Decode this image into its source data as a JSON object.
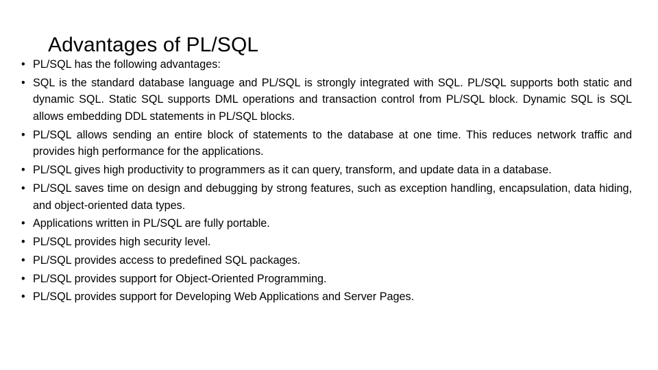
{
  "slide": {
    "title": "Advantages of PL/SQL",
    "bullet_marker": "•",
    "background_color": "#ffffff",
    "text_color": "#000000",
    "bullets": [
      {
        "id": "intro",
        "text": "PL/SQL has the following advantages:",
        "wraps": false
      },
      {
        "id": "standard-language",
        "text": "SQL is the standard database language and PL/SQL is strongly integrated with SQL. PL/SQL supports both static and dynamic SQL. Static SQL supports DML operations and transaction control from PL/SQL block. Dynamic SQL is SQL allows embedding DDL statements in PL/SQL blocks.",
        "wraps": true
      },
      {
        "id": "block-sending",
        "text": "PL/SQL allows sending an entire block of statements to the database at one time. This reduces network traffic and provides high performance for the applications.",
        "wraps": true
      },
      {
        "id": "productivity",
        "text": "PL/SQL gives high productivity to programmers as it can query, transform, and update data in a database.",
        "wraps": true
      },
      {
        "id": "saves-time",
        "text": "PL/SQL saves time on design and debugging by strong features, such as exception handling, encapsulation, data hiding, and object-oriented data types.",
        "wraps": true
      },
      {
        "id": "portable",
        "text": "Applications written in PL/SQL are fully portable.",
        "wraps": false
      },
      {
        "id": "security",
        "text": "PL/SQL provides high security level.",
        "wraps": false
      },
      {
        "id": "predefined-packages",
        "text": "PL/SQL provides access to predefined SQL packages.",
        "wraps": false
      },
      {
        "id": "oop-support",
        "text": "PL/SQL provides support for Object-Oriented Programming.",
        "wraps": false
      },
      {
        "id": "web-support",
        "text": "PL/SQL provides support for Developing Web Applications and Server Pages.",
        "wraps": false
      }
    ]
  }
}
